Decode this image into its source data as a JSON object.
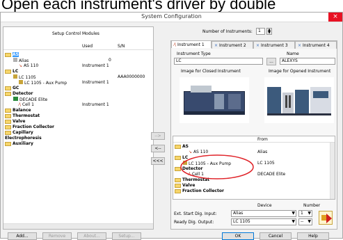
{
  "caption": "Open each instrument's driver by double",
  "window": {
    "title": "System Configuration",
    "close": "×"
  },
  "left": {
    "header": "Setup Control Modules",
    "columns": [
      "Used",
      "S/N"
    ],
    "tree": {
      "as": "AS",
      "alias": "Alias",
      "alias_used": "0",
      "as110": "AS 110",
      "as110_used": "Instrument 1",
      "lc": "LC",
      "lc1105": "LC 1105",
      "lc1105_sn": "AAA0000000",
      "lc1105_pump": "LC 1105 - Aux Pump",
      "lc1105_pump_used": "Instrument 1",
      "gc": "GC",
      "detector": "Detector",
      "decade": "DECADE Elite",
      "cell1": "Cell 1",
      "cell1_used": "Instrument 1",
      "balance": "Balance",
      "thermostat": "Thermostat",
      "valve": "Valve",
      "fraction": "Fraction Collector",
      "capillary": "Capillary Electrophoresis",
      "auxiliary": "Auxiliary"
    },
    "buttons": {
      "add": "Add...",
      "remove": "Remove",
      "about": "About...",
      "setup": "Setup..."
    }
  },
  "transfer": {
    "right": "-->",
    "left": "<--",
    "all_left": "<<<"
  },
  "right": {
    "num_label": "Number of Instruments:",
    "num_value": "1",
    "tabs": [
      "Instrument 1",
      "Instrument 2",
      "Instrument 3",
      "Instrument 4"
    ],
    "type_label": "Instrument Type",
    "type_value": "LC",
    "browse": "...",
    "name_label": "Name",
    "name_value": "ALEXYS",
    "closed_label": "Image for Closed Instrument",
    "opened_label": "Image for Opened Instrument",
    "from_header": "From",
    "list": {
      "as": "AS",
      "as110": "AS 110",
      "as110_from": "Alias",
      "lc": "LC",
      "lc1105_pump": "LC 1105 - Aux Pump",
      "lc1105_from": "LC 1105",
      "detector": "Detector",
      "cell1": "Cell 1",
      "cell1_from": "DECADE Elite",
      "thermostat": "Thermostat",
      "valve": "Valve",
      "fraction": "Fraction Collector"
    },
    "device_label": "Device",
    "number_label": "Number",
    "ext_label": "Ext. Start Dig. Input:",
    "ext_device": "Alias",
    "ext_number": "1",
    "ready_label": "Ready Dig. Output:",
    "ready_device": "LC 1105",
    "ready_number": "--"
  },
  "footer": {
    "ok": "OK",
    "cancel": "Cancel",
    "help": "Help"
  },
  "accent": "#e81123"
}
